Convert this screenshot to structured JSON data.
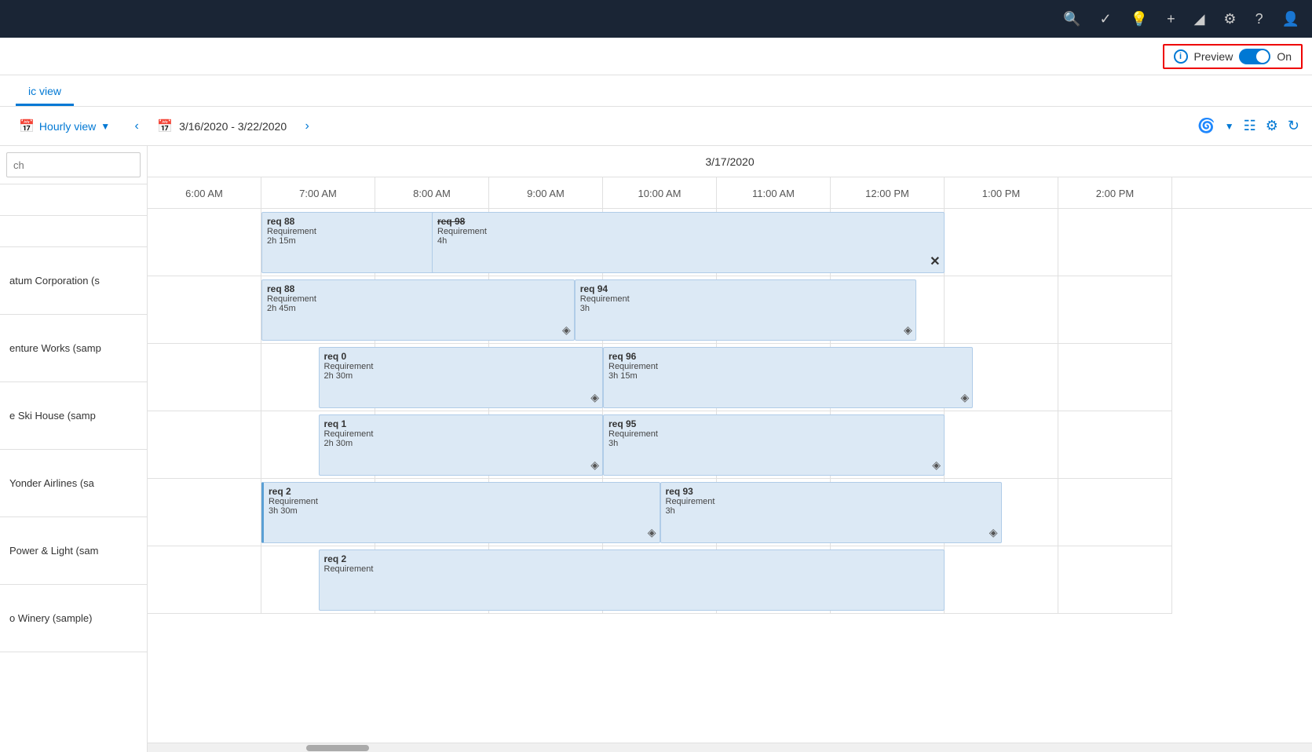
{
  "topNav": {
    "icons": [
      "search",
      "check-circle",
      "lightbulb",
      "plus",
      "filter",
      "settings",
      "help",
      "user"
    ]
  },
  "previewBar": {
    "infoLabel": "i",
    "previewLabel": "Preview",
    "toggleState": "On",
    "onLabel": "On"
  },
  "tabs": [
    {
      "label": "ic view",
      "active": true
    }
  ],
  "toolbar": {
    "viewLabel": "Hourly view",
    "prevArrow": "‹",
    "nextArrow": "›",
    "dateRange": "3/16/2020 - 3/22/2020",
    "calendarIcon": "📅"
  },
  "dateHeader": "3/17/2020",
  "timeColumns": [
    "6:00 AM",
    "7:00 AM",
    "8:00 AM",
    "9:00 AM",
    "10:00 AM",
    "11:00 AM",
    "12:00 PM",
    "1:00 PM",
    "2:00 PM"
  ],
  "resources": [
    "atum Corporation (s",
    "enture Works (samp",
    "e Ski House (samp",
    "Yonder Airlines (sa",
    "Power & Light (sam",
    "o Winery (sample)"
  ],
  "events": [
    {
      "row": 0,
      "col": 1,
      "span": 2.17,
      "title": "req 88",
      "type": "Requirement",
      "duration": "2h 15m",
      "strikethrough": false,
      "icon": "diamond"
    },
    {
      "row": 0,
      "col": 2.5,
      "span": 4,
      "title": "req 98",
      "type": "Requirement",
      "duration": "4h",
      "strikethrough": true,
      "icon": "x"
    },
    {
      "row": 1,
      "col": 1,
      "span": 2.75,
      "title": "req 88",
      "type": "Requirement",
      "duration": "2h 45m",
      "strikethrough": false,
      "icon": "diamond"
    },
    {
      "row": 1,
      "col": 3.75,
      "span": 3,
      "title": "req 94",
      "type": "Requirement",
      "duration": "3h",
      "strikethrough": false,
      "icon": "diamond"
    },
    {
      "row": 2,
      "col": 1.5,
      "span": 2.5,
      "title": "req 0",
      "type": "Requirement",
      "duration": "2h 30m",
      "strikethrough": false,
      "icon": "diamond"
    },
    {
      "row": 2,
      "col": 4,
      "span": 3.25,
      "title": "req 96",
      "type": "Requirement",
      "duration": "3h 15m",
      "strikethrough": false,
      "icon": "diamond"
    },
    {
      "row": 3,
      "col": 1.5,
      "span": 2.5,
      "title": "req 1",
      "type": "Requirement",
      "duration": "2h 30m",
      "strikethrough": false,
      "icon": "diamond"
    },
    {
      "row": 3,
      "col": 4,
      "span": 3,
      "title": "req 95",
      "type": "Requirement",
      "duration": "3h",
      "strikethrough": false,
      "icon": "diamond"
    },
    {
      "row": 4,
      "col": 1,
      "span": 3.5,
      "title": "req 2",
      "type": "Requirement",
      "duration": "3h 30m",
      "strikethrough": false,
      "icon": "diamond"
    },
    {
      "row": 4,
      "col": 4.5,
      "span": 3,
      "title": "req 93",
      "type": "Requirement",
      "duration": "3h",
      "strikethrough": false,
      "icon": "diamond"
    },
    {
      "row": 5,
      "col": 1.5,
      "span": 5,
      "title": "req 2",
      "type": "Requirement",
      "duration": "",
      "strikethrough": false,
      "icon": "none"
    }
  ],
  "scrollbar": {
    "thumbOffset": 200
  }
}
